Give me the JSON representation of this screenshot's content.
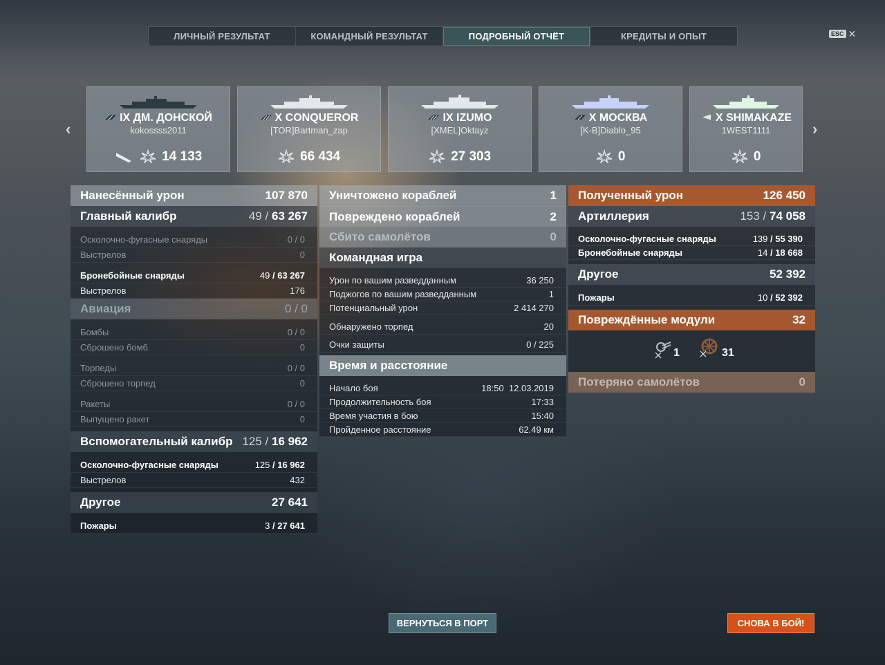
{
  "tabs": [
    {
      "label": "ЛИЧНЫЙ РЕЗУЛЬТАТ",
      "active": false
    },
    {
      "label": "КОМАНДНЫЙ РЕЗУЛЬТАТ",
      "active": false
    },
    {
      "label": "ПОДРОБНЫЙ ОТЧЁТ",
      "active": true
    },
    {
      "label": "КРЕДИТЫ И ОПЫТ",
      "active": false
    }
  ],
  "esc_label": "ESC",
  "ships": [
    {
      "name": "IX ДМ. ДОНСКОЙ",
      "player": "kokossss2011",
      "score": "14 133",
      "class_icon": "cruiser-icon"
    },
    {
      "name": "X CONQUEROR",
      "player": "[TOR]Bartman_zap",
      "score": "66 434",
      "class_icon": "battleship-icon"
    },
    {
      "name": "IX IZUMO",
      "player": "[XMEL]Oktayz",
      "score": "27 303",
      "class_icon": "battleship-icon"
    },
    {
      "name": "X МОСКВА",
      "player": "[K-B]Diablo_95",
      "score": "0",
      "class_icon": "cruiser-icon"
    },
    {
      "name": "X SHIMAKAZE",
      "player": "1WEST1111",
      "score": "0",
      "class_icon": "destroyer-icon"
    }
  ],
  "left": {
    "dealt": {
      "label": "Нанесённый урон",
      "value": "107 870"
    },
    "main": {
      "label": "Главный калибр",
      "hits": "49",
      "dmg": "63 267"
    },
    "he": {
      "label": "Осколочно-фугасные снаряды",
      "value": "0 / 0"
    },
    "he_shots": {
      "label": "Выстрелов",
      "value": "0"
    },
    "ap": {
      "label": "Бронебойные снаряды",
      "hits": "49",
      "dmg": "63 267"
    },
    "ap_shots": {
      "label": "Выстрелов",
      "value": "176"
    },
    "aviation": {
      "label": "Авиация",
      "value": "0 / 0"
    },
    "bombs": {
      "label": "Бомбы",
      "value": "0 / 0"
    },
    "bombs_dropped": {
      "label": "Сброшено бомб",
      "value": "0"
    },
    "torps": {
      "label": "Торпеды",
      "value": "0 / 0"
    },
    "torps_dropped": {
      "label": "Сброшено торпед",
      "value": "0"
    },
    "rockets": {
      "label": "Ракеты",
      "value": "0 / 0"
    },
    "rockets_fired": {
      "label": "Выпущено ракет",
      "value": "0"
    },
    "secondary": {
      "label": "Вспомогательный калибр",
      "hits": "125",
      "dmg": "16 962"
    },
    "sec_he": {
      "label": "Осколочно-фугасные снаряды",
      "hits": "125",
      "dmg": "16 962"
    },
    "sec_shots": {
      "label": "Выстрелов",
      "value": "432"
    },
    "other": {
      "label": "Другое",
      "value": "27 641"
    },
    "fires": {
      "label": "Пожары",
      "hits": "3",
      "dmg": "27 641"
    }
  },
  "middle": {
    "destroyed": {
      "label": "Уничтожено кораблей",
      "value": "1"
    },
    "damaged": {
      "label": "Повреждено кораблей",
      "value": "2"
    },
    "planes": {
      "label": "Сбито самолётов",
      "value": "0"
    },
    "team": {
      "label": "Командная игра"
    },
    "spot_dmg": {
      "label": "Урон по вашим разведданным",
      "value": "36 250"
    },
    "spot_fires": {
      "label": "Поджогов по вашим разведданным",
      "value": "1"
    },
    "potential": {
      "label": "Потенциальный урон",
      "value": "2 414 270"
    },
    "torps_spotted": {
      "label": "Обнаружено торпед",
      "value": "20"
    },
    "defense": {
      "label": "Очки защиты",
      "value": "0 / 225"
    },
    "time": {
      "label": "Время и расстояние"
    },
    "start": {
      "label": "Начало боя",
      "value": "18:50  12.03.2019"
    },
    "duration": {
      "label": "Продолжительность боя",
      "value": "17:33"
    },
    "participation": {
      "label": "Время участия в бою",
      "value": "15:40"
    },
    "distance": {
      "label": "Пройденное расстояние",
      "value": "62.49 км"
    }
  },
  "right": {
    "received": {
      "label": "Полученный урон",
      "value": "126 450"
    },
    "artillery": {
      "label": "Артиллерия",
      "hits": "153",
      "dmg": "74 058"
    },
    "he": {
      "label": "Осколочно-фугасные снаряды",
      "hits": "139",
      "dmg": "55 390"
    },
    "ap": {
      "label": "Бронебойные снаряды",
      "hits": "14",
      "dmg": "18 668"
    },
    "other": {
      "label": "Другое",
      "value": "52 392"
    },
    "fires": {
      "label": "Пожары",
      "hits": "10",
      "dmg": "52 392"
    },
    "modules": {
      "label": "Повреждённые модули",
      "value": "32"
    },
    "mod_a": {
      "count": "1"
    },
    "mod_b": {
      "count": "31"
    },
    "planes_lost": {
      "label": "Потеряно самолётов",
      "value": "0"
    }
  },
  "buttons": {
    "port": "ВЕРНУТЬСЯ В ПОРТ",
    "battle": "СНОВА В БОЙ!"
  },
  "colors": {
    "accent_orange": "#d6521a",
    "header_orange": "#b65a2a",
    "active_tab": "#466e6e"
  }
}
